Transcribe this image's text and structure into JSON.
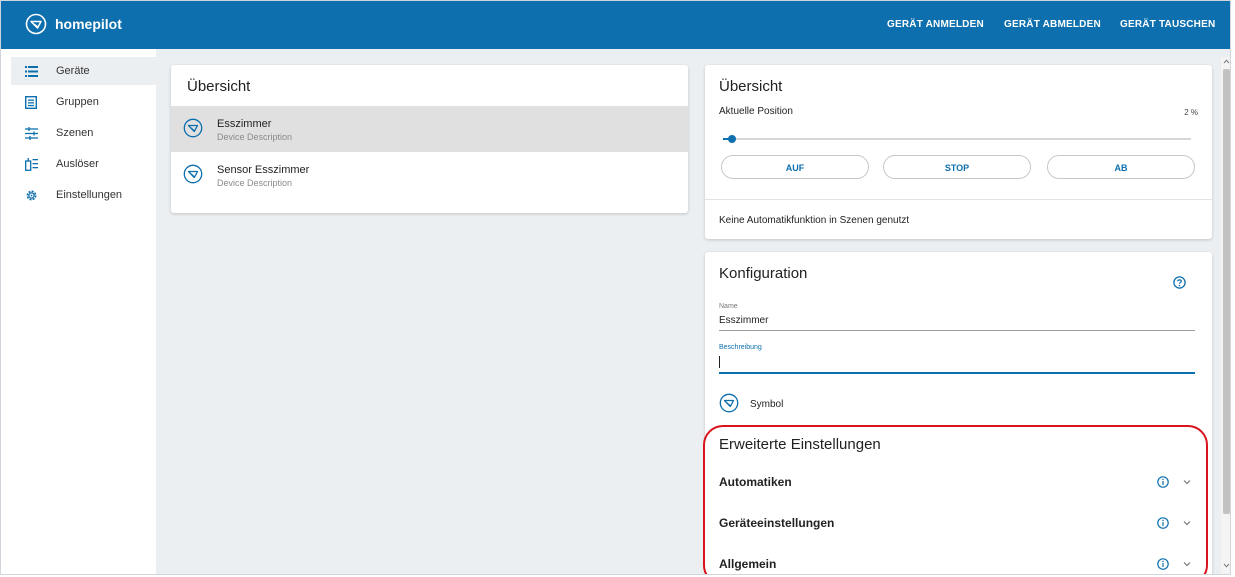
{
  "header": {
    "brand": "homepilot",
    "actions": [
      "GERÄT ANMELDEN",
      "GERÄT ABMELDEN",
      "GERÄT TAUSCHEN"
    ]
  },
  "sidebar": {
    "items": [
      {
        "label": "Geräte",
        "icon": "list-icon",
        "active": true
      },
      {
        "label": "Gruppen",
        "icon": "group-icon",
        "active": false
      },
      {
        "label": "Szenen",
        "icon": "scenes-icon",
        "active": false
      },
      {
        "label": "Auslöser",
        "icon": "trigger-icon",
        "active": false
      },
      {
        "label": "Einstellungen",
        "icon": "gear-icon",
        "active": false
      }
    ]
  },
  "device_list": {
    "title": "Übersicht",
    "devices": [
      {
        "name": "Esszimmer",
        "description": "Device Description",
        "selected": true
      },
      {
        "name": "Sensor Esszimmer",
        "description": "Device Description",
        "selected": false
      }
    ]
  },
  "overview": {
    "title": "Übersicht",
    "position_label": "Aktuelle Position",
    "position_value": "2 %",
    "position_fraction": 0.02,
    "buttons": {
      "up": "AUF",
      "stop": "STOP",
      "down": "AB"
    },
    "automation_note": "Keine Automatikfunktion in Szenen genutzt"
  },
  "config": {
    "title": "Konfiguration",
    "name_label": "Name",
    "name_value": "Esszimmer",
    "description_label": "Beschreibung",
    "description_value": "",
    "symbol_label": "Symbol"
  },
  "advanced": {
    "title": "Erweiterte Einstellungen",
    "sections": [
      "Automatiken",
      "Geräteeinstellungen",
      "Allgemein"
    ]
  },
  "colors": {
    "accent": "#0d6fae",
    "highlight": "#d9141c"
  }
}
